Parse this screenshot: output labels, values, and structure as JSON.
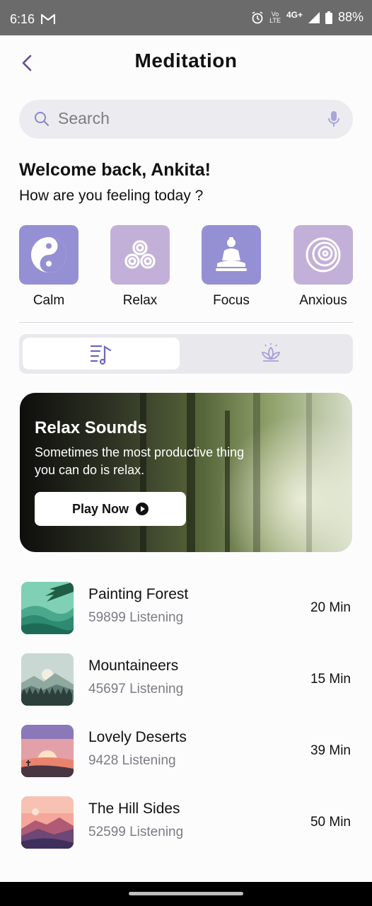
{
  "status_bar": {
    "time": "6:16",
    "network": "Vo¹\nLTE",
    "signal_label": "4G+",
    "battery": "88%"
  },
  "header": {
    "title": "Meditation"
  },
  "search": {
    "placeholder": "Search"
  },
  "greeting": {
    "welcome": "Welcome back, Ankita!",
    "prompt": "How are you feeling today ?"
  },
  "moods": [
    {
      "label": "Calm",
      "icon": "yin-yang-icon",
      "color": "#9590d4"
    },
    {
      "label": "Relax",
      "icon": "triskele-icon",
      "color": "#c3b0d8"
    },
    {
      "label": "Focus",
      "icon": "buddha-icon",
      "color": "#9590d4"
    },
    {
      "label": "Anxious",
      "icon": "spiral-icon",
      "color": "#c3b0d8"
    }
  ],
  "toggle": {
    "selected_icon": "music-list-icon",
    "other_icon": "lotus-icon"
  },
  "banner": {
    "title": "Relax Sounds",
    "subtitle": "Sometimes the most productive thing you can do is relax.",
    "button": "Play Now"
  },
  "tracks": [
    {
      "name": "Painting Forest",
      "listening": "59899 Listening",
      "duration": "20 Min"
    },
    {
      "name": "Mountaineers",
      "listening": "45697 Listening",
      "duration": "15 Min"
    },
    {
      "name": "Lovely Deserts",
      "listening": "9428 Listening",
      "duration": "39 Min"
    },
    {
      "name": "The Hill Sides",
      "listening": "52599 Listening",
      "duration": "50 Min"
    }
  ],
  "colors": {
    "accent": "#8b86cc",
    "tile_dark": "#9590d4",
    "tile_light": "#c3b0d8",
    "text_secondary": "#7d7b84"
  }
}
